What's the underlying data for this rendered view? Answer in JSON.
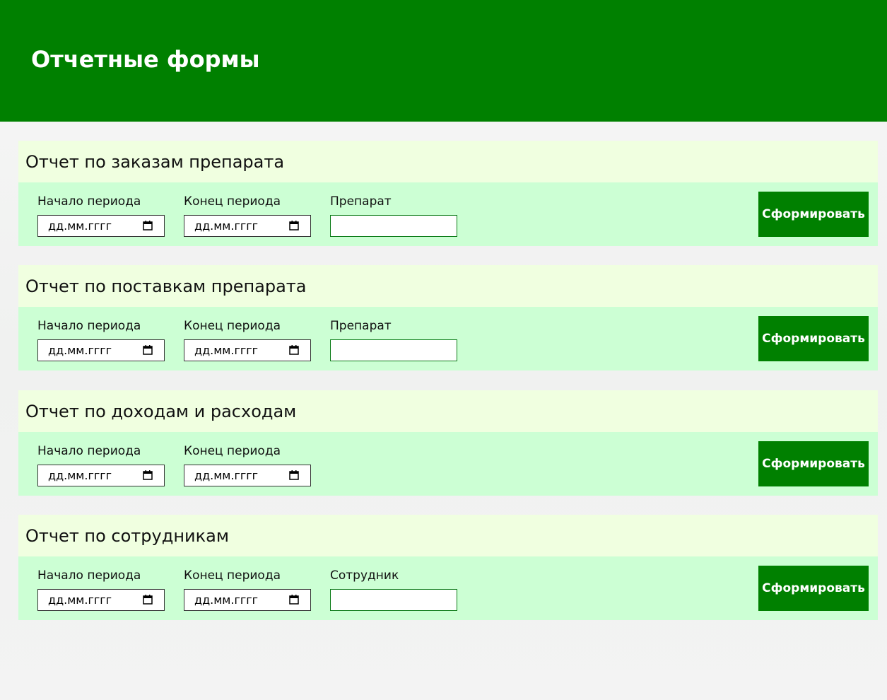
{
  "header": {
    "title": "Отчетные формы"
  },
  "colors": {
    "header_bg": "#008000",
    "title_bar_bg": "#f0ffe0",
    "body_bg": "#ccffd4",
    "button_bg": "#008000"
  },
  "common": {
    "start_label": "Начало периода",
    "end_label": "Конец периода",
    "date_placeholder": "дд.мм.гггг",
    "submit_label": "Сформировать",
    "calendar_icon": "calendar-icon"
  },
  "reports": [
    {
      "title": "Отчет по заказам препарата",
      "extra_label": "Препарат",
      "extra_value": ""
    },
    {
      "title": "Отчет по поставкам препарата",
      "extra_label": "Препарат",
      "extra_value": ""
    },
    {
      "title": "Отчет по доходам и расходам"
    },
    {
      "title": "Отчет по сотрудникам",
      "extra_label": "Сотрудник",
      "extra_value": ""
    }
  ]
}
